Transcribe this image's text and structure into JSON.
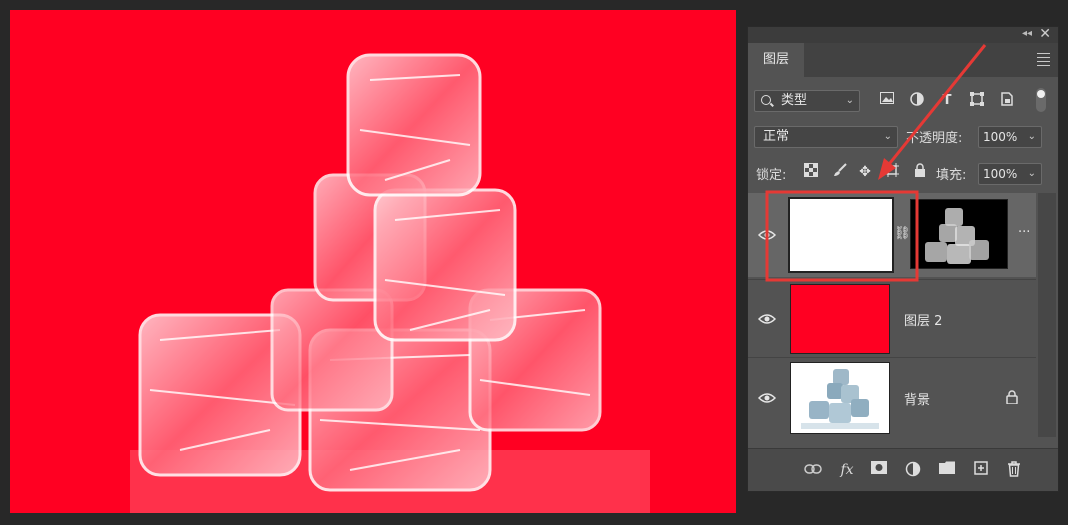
{
  "panel": {
    "tab_label": "图层",
    "filter": {
      "kind_label": "类型",
      "icons": [
        "image-filter-icon",
        "adjustment-filter-icon",
        "type-filter-icon",
        "shape-filter-icon",
        "smart-object-filter-icon",
        "filter-toggle-icon"
      ]
    },
    "blend_mode": "正常",
    "opacity_label": "不透明度:",
    "opacity_value": "100%",
    "lock_label": "锁定:",
    "lock_icons": [
      "lock-transparent-pixels-icon",
      "lock-image-pixels-icon",
      "lock-position-icon",
      "lock-artboard-icon",
      "lock-all-icon"
    ],
    "fill_label": "填充:",
    "fill_value": "100%",
    "layers": [
      {
        "name": "",
        "type": "layer-with-mask",
        "visible": true,
        "thumb_color": "#ffffff",
        "selected": true
      },
      {
        "name": "图层 2",
        "type": "solid-fill",
        "visible": true,
        "thumb_color": "#ff0022"
      },
      {
        "name": "背景",
        "type": "background",
        "visible": true,
        "locked": true
      }
    ],
    "bottom_icons": [
      "link-layers-icon",
      "fx-icon",
      "add-mask-icon",
      "adjustment-layer-icon",
      "group-folder-icon",
      "new-layer-icon",
      "delete-layer-icon"
    ],
    "fx_text": "fx"
  },
  "colors": {
    "canvas": "#ff0022",
    "panel": "#535353",
    "annotation": "#e53935"
  }
}
